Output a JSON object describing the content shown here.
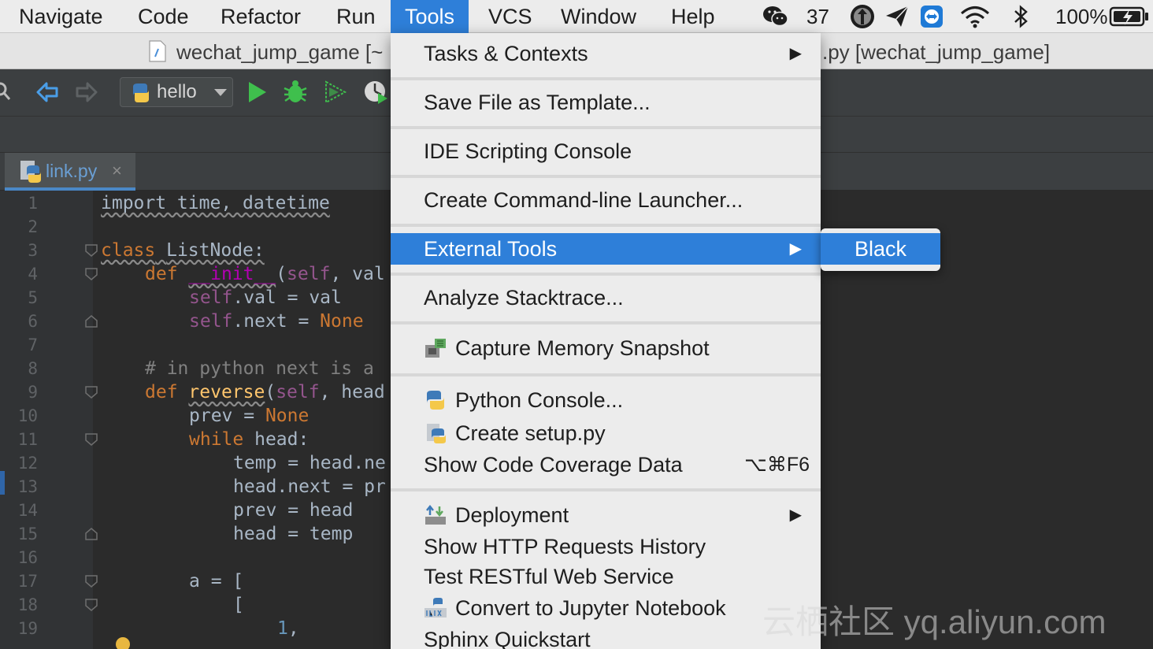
{
  "menubar": {
    "items": [
      "Navigate",
      "Code",
      "Refactor",
      "Run",
      "Tools",
      "VCS",
      "Window",
      "Help"
    ],
    "active": "Tools",
    "tray": {
      "wechat_count": "37",
      "battery": "100%"
    }
  },
  "titlebar": {
    "left_title": "wechat_jump_game [~",
    "right_title": ".py [wechat_jump_game]"
  },
  "toolbar": {
    "run_config": "hello"
  },
  "editor": {
    "tab_label": "link.py",
    "tab_close": "×",
    "line_numbers": [
      "1",
      "2",
      "3",
      "4",
      "5",
      "6",
      "7",
      "8",
      "9",
      "10",
      "11",
      "12",
      "13",
      "14",
      "15",
      "16",
      "17",
      "18",
      "19"
    ],
    "code": {
      "l1": "import time, datetime",
      "l3_kw": "class",
      "l3_name": "ListNode:",
      "l4_kw": "def",
      "l4_fn": "__init__",
      "l4_self": "self",
      "l4_rest": ", val",
      "l5_self": "self",
      "l5_rest": ".val = val",
      "l6_self": "self",
      "l6_rest": ".next = ",
      "l6_none": "None",
      "l8": "# in python next is a",
      "l9_kw": "def",
      "l9_fn": "reverse",
      "l9_self": "self",
      "l9_rest": ", head",
      "l10_a": "prev = ",
      "l10_none": "None",
      "l11_kw": "while",
      "l11_rest": " head:",
      "l12": "temp = head.ne",
      "l13": "head.next = pr",
      "l14": "prev = head",
      "l15": "head = temp",
      "l17": "a = [",
      "l18": "[",
      "l19_num": "1",
      "l19_rest": ","
    }
  },
  "tools_menu": {
    "items": [
      {
        "label": "Tasks & Contexts",
        "arrow": "▶"
      },
      {
        "label": "Save File as Template..."
      },
      {
        "label": "IDE Scripting Console"
      },
      {
        "label": "Create Command-line Launcher..."
      },
      {
        "label": "External Tools",
        "arrow": "▶"
      },
      {
        "label": "Analyze Stacktrace..."
      },
      {
        "label": "Capture Memory Snapshot"
      },
      {
        "label": "Python Console..."
      },
      {
        "label": "Create setup.py"
      },
      {
        "label": "Show Code Coverage Data",
        "shortcut": "⌥⌘F6"
      },
      {
        "label": "Deployment",
        "arrow": "▶"
      },
      {
        "label": "Show HTTP Requests History"
      },
      {
        "label": "Test RESTful Web Service"
      },
      {
        "label": "Convert to Jupyter Notebook"
      },
      {
        "label": "Sphinx Quickstart"
      }
    ],
    "highlighted": "External Tools"
  },
  "submenu": {
    "items": [
      "Black"
    ]
  },
  "watermark": "云栖社区 yq.aliyun.com",
  "colors": {
    "accent": "#2e7fd9",
    "editor_bg": "#2b2b2b",
    "menu_bg": "#ececec"
  },
  "icons": [
    "wechat-icon",
    "upload-icon",
    "send-icon",
    "teamviewer-icon",
    "wifi-icon",
    "bluetooth-icon",
    "battery-icon",
    "search-icon",
    "back-arrow-icon",
    "forward-arrow-icon",
    "python-icon",
    "run-icon",
    "debug-icon",
    "coverage-icon",
    "profile-icon",
    "memory-snapshot-icon",
    "python-console-icon",
    "setup-py-icon",
    "deployment-icon",
    "jupyter-icon"
  ]
}
